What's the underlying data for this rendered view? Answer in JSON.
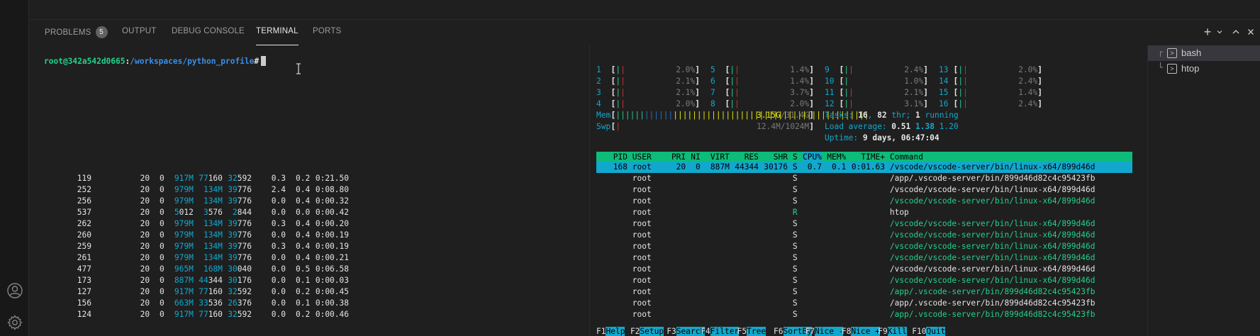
{
  "panel": {
    "tabs": [
      {
        "label": "PROBLEMS",
        "badge": "5"
      },
      {
        "label": "OUTPUT"
      },
      {
        "label": "DEBUG CONSOLE"
      },
      {
        "label": "TERMINAL"
      },
      {
        "label": "PORTS"
      }
    ]
  },
  "terminal": {
    "prompt_user": "root@342a542d0665",
    "prompt_sep": ":",
    "prompt_path": "/workspaces/python_profile",
    "prompt_char": "#"
  },
  "terminal_list": [
    {
      "tree": "┌",
      "name": "bash"
    },
    {
      "tree": "└",
      "name": "htop"
    }
  ],
  "htop": {
    "cpus": [
      {
        "id": "1",
        "bar": "||",
        "pct": "2.0%"
      },
      {
        "id": "2",
        "bar": "||",
        "pct": "2.1%"
      },
      {
        "id": "3",
        "bar": "||",
        "pct": "2.1%"
      },
      {
        "id": "4",
        "bar": "||",
        "pct": "2.0%"
      },
      {
        "id": "5",
        "bar": "||",
        "pct": "1.4%"
      },
      {
        "id": "6",
        "bar": "||",
        "pct": "1.4%"
      },
      {
        "id": "7",
        "bar": "||",
        "pct": "3.7%"
      },
      {
        "id": "8",
        "bar": "||",
        "pct": "2.0%"
      },
      {
        "id": "9",
        "bar": "||",
        "pct": "2.4%"
      },
      {
        "id": "10",
        "bar": "|",
        "pct": "1.0%"
      },
      {
        "id": "11",
        "bar": "||",
        "pct": "2.1%"
      },
      {
        "id": "12",
        "bar": "||",
        "pct": "3.1%"
      },
      {
        "id": "13",
        "bar": "||",
        "pct": "2.0%"
      },
      {
        "id": "14",
        "bar": "||",
        "pct": "2.4%"
      },
      {
        "id": "15",
        "bar": "||",
        "pct": "1.4%"
      },
      {
        "id": "16",
        "bar": "||",
        "pct": "2.4%"
      }
    ],
    "mem": {
      "label": "Mem",
      "bar_green": "||||||",
      "bar_blue": "||||||",
      "bar_yellow": "|||||||||||||||||||||||||||||||||||||||||",
      "used": "3.15G",
      "total": "31.4G"
    },
    "swp": {
      "label": "Swp",
      "bar": "|",
      "used": "12.4M",
      "total": "1024M"
    },
    "tasks": {
      "label": "Tasks:",
      "count": "16",
      "thr": "82",
      "thr_label": "thr;",
      "running": "1",
      "running_label": "running"
    },
    "load": {
      "label": "Load average:",
      "v1": "0.51",
      "v5": "1.38",
      "v15": "1.20"
    },
    "uptime": {
      "label": "Uptime:",
      "value": "9 days, 06:47:04"
    },
    "columns": [
      "PID",
      "USER",
      "PRI",
      "NI",
      "VIRT",
      "RES",
      "SHR",
      "S",
      "CPU%",
      "MEM%",
      "TIME+",
      "Command"
    ],
    "processes": [
      {
        "pid": "168",
        "user": "root",
        "pri": "20",
        "ni": "0",
        "virt": "887M",
        "res": "44344",
        "shr": "30176",
        "s": "S",
        "cpu": "0.7",
        "mem": "0.1",
        "time": "0:01.63",
        "cmd": "/vscode/vscode-server/bin/linux-x64/899d46d",
        "thread": false
      },
      {
        "pid": "119",
        "user": "root",
        "pri": "20",
        "ni": "0",
        "virt": "917M",
        "res": "77160",
        "shr": "32592",
        "s": "S",
        "cpu": "0.3",
        "mem": "0.2",
        "time": "0:21.50",
        "cmd": "/app/.vscode-server/bin/899d46d82c4c95423fb",
        "thread": false
      },
      {
        "pid": "252",
        "user": "root",
        "pri": "20",
        "ni": "0",
        "virt": "979M",
        "res": "134M",
        "shr": "39776",
        "s": "S",
        "cpu": "2.4",
        "mem": "0.4",
        "time": "0:08.80",
        "cmd": "/vscode/vscode-server/bin/linux-x64/899d46d",
        "thread": false
      },
      {
        "pid": "256",
        "user": "root",
        "pri": "20",
        "ni": "0",
        "virt": "979M",
        "res": "134M",
        "shr": "39776",
        "s": "S",
        "cpu": "0.0",
        "mem": "0.4",
        "time": "0:00.32",
        "cmd": "/vscode/vscode-server/bin/linux-x64/899d46d",
        "thread": true
      },
      {
        "pid": "537",
        "user": "root",
        "pri": "20",
        "ni": "0",
        "virt": "5012",
        "res": "3576",
        "shr": "2844",
        "s": "R",
        "cpu": "0.0",
        "mem": "0.0",
        "time": "0:00.42",
        "cmd": "htop",
        "thread": false
      },
      {
        "pid": "262",
        "user": "root",
        "pri": "20",
        "ni": "0",
        "virt": "979M",
        "res": "134M",
        "shr": "39776",
        "s": "S",
        "cpu": "0.3",
        "mem": "0.4",
        "time": "0:00.20",
        "cmd": "/vscode/vscode-server/bin/linux-x64/899d46d",
        "thread": true
      },
      {
        "pid": "260",
        "user": "root",
        "pri": "20",
        "ni": "0",
        "virt": "979M",
        "res": "134M",
        "shr": "39776",
        "s": "S",
        "cpu": "0.0",
        "mem": "0.4",
        "time": "0:00.19",
        "cmd": "/vscode/vscode-server/bin/linux-x64/899d46d",
        "thread": true
      },
      {
        "pid": "259",
        "user": "root",
        "pri": "20",
        "ni": "0",
        "virt": "979M",
        "res": "134M",
        "shr": "39776",
        "s": "S",
        "cpu": "0.3",
        "mem": "0.4",
        "time": "0:00.19",
        "cmd": "/vscode/vscode-server/bin/linux-x64/899d46d",
        "thread": true
      },
      {
        "pid": "261",
        "user": "root",
        "pri": "20",
        "ni": "0",
        "virt": "979M",
        "res": "134M",
        "shr": "39776",
        "s": "S",
        "cpu": "0.0",
        "mem": "0.4",
        "time": "0:00.21",
        "cmd": "/vscode/vscode-server/bin/linux-x64/899d46d",
        "thread": true
      },
      {
        "pid": "477",
        "user": "root",
        "pri": "20",
        "ni": "0",
        "virt": "965M",
        "res": "168M",
        "shr": "30040",
        "s": "S",
        "cpu": "0.0",
        "mem": "0.5",
        "time": "0:06.58",
        "cmd": "/vscode/vscode-server/bin/linux-x64/899d46d",
        "thread": false
      },
      {
        "pid": "173",
        "user": "root",
        "pri": "20",
        "ni": "0",
        "virt": "887M",
        "res": "44344",
        "shr": "30176",
        "s": "S",
        "cpu": "0.0",
        "mem": "0.1",
        "time": "0:00.03",
        "cmd": "/vscode/vscode-server/bin/linux-x64/899d46d",
        "thread": true
      },
      {
        "pid": "127",
        "user": "root",
        "pri": "20",
        "ni": "0",
        "virt": "917M",
        "res": "77160",
        "shr": "32592",
        "s": "S",
        "cpu": "0.0",
        "mem": "0.2",
        "time": "0:00.45",
        "cmd": "/app/.vscode-server/bin/899d46d82c4c95423fb",
        "thread": true
      },
      {
        "pid": "156",
        "user": "root",
        "pri": "20",
        "ni": "0",
        "virt": "663M",
        "res": "33536",
        "shr": "26376",
        "s": "S",
        "cpu": "0.0",
        "mem": "0.1",
        "time": "0:00.38",
        "cmd": "/app/.vscode-server/bin/899d46d82c4c95423fb",
        "thread": false
      },
      {
        "pid": "124",
        "user": "root",
        "pri": "20",
        "ni": "0",
        "virt": "917M",
        "res": "77160",
        "shr": "32592",
        "s": "S",
        "cpu": "0.0",
        "mem": "0.2",
        "time": "0:00.46",
        "cmd": "/app/.vscode-server/bin/899d46d82c4c95423fb",
        "thread": true
      }
    ],
    "fkeys": [
      {
        "key": "F1",
        "label": "Help"
      },
      {
        "key": "F2",
        "label": "Setup"
      },
      {
        "key": "F3",
        "label": "Search"
      },
      {
        "key": "F4",
        "label": "Filter"
      },
      {
        "key": "F5",
        "label": "Tree"
      },
      {
        "key": "F6",
        "label": "SortBy"
      },
      {
        "key": "F7",
        "label": "Nice -"
      },
      {
        "key": "F8",
        "label": "Nice +"
      },
      {
        "key": "F9",
        "label": "Kill"
      },
      {
        "key": "F10",
        "label": "Quit"
      }
    ]
  }
}
